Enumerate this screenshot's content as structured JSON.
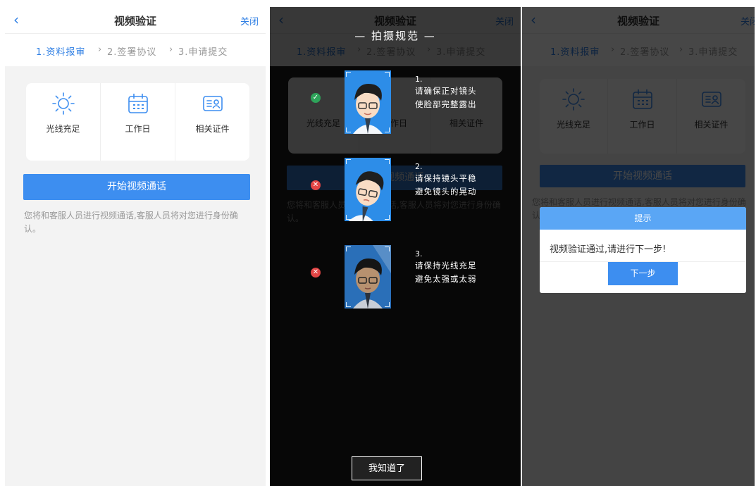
{
  "nav": {
    "back_icon": "chevron-left-icon",
    "title": "视频验证",
    "close": "关闭"
  },
  "steps": [
    {
      "label": "1.资料报审",
      "state": "active"
    },
    {
      "sep": "›",
      "label": "2.签署协议",
      "state": "inactive"
    },
    {
      "sep": "›",
      "label": "3.申请提交",
      "state": "inactive"
    }
  ],
  "requirements": [
    {
      "icon": "sun-icon",
      "label": "光线充足"
    },
    {
      "icon": "calendar-icon",
      "label": "工作日"
    },
    {
      "icon": "id-card-icon",
      "label": "相关证件"
    }
  ],
  "start_button": "开始视频通话",
  "hint": "您将和客服人员进行视频通话,客服人员将对您进行身份确认。",
  "guide": {
    "title": "— 拍摄规范 —",
    "rules": [
      {
        "num": "1.",
        "line1": "请确保正对镜头",
        "line2": "使脸部完整露出",
        "status": "correct",
        "status_icon": "check-icon"
      },
      {
        "num": "2.",
        "line1": "请保持镜头平稳",
        "line2": "避免镜头的晃动",
        "status": "wrong",
        "status_icon": "cross-icon"
      },
      {
        "num": "3.",
        "line1": "请保持光线充足",
        "line2": "避免太强或太弱",
        "status": "wrong",
        "status_icon": "cross-icon"
      }
    ],
    "confirm": "我知道了"
  },
  "dialog": {
    "title": "提示",
    "message": "视频验证通过,请进行下一步!",
    "button": "下一步"
  },
  "colors": {
    "accent": "#3d8ef0",
    "dialog_header": "#5aa6f5",
    "ok": "#2ea35a",
    "bad": "#e24545"
  }
}
